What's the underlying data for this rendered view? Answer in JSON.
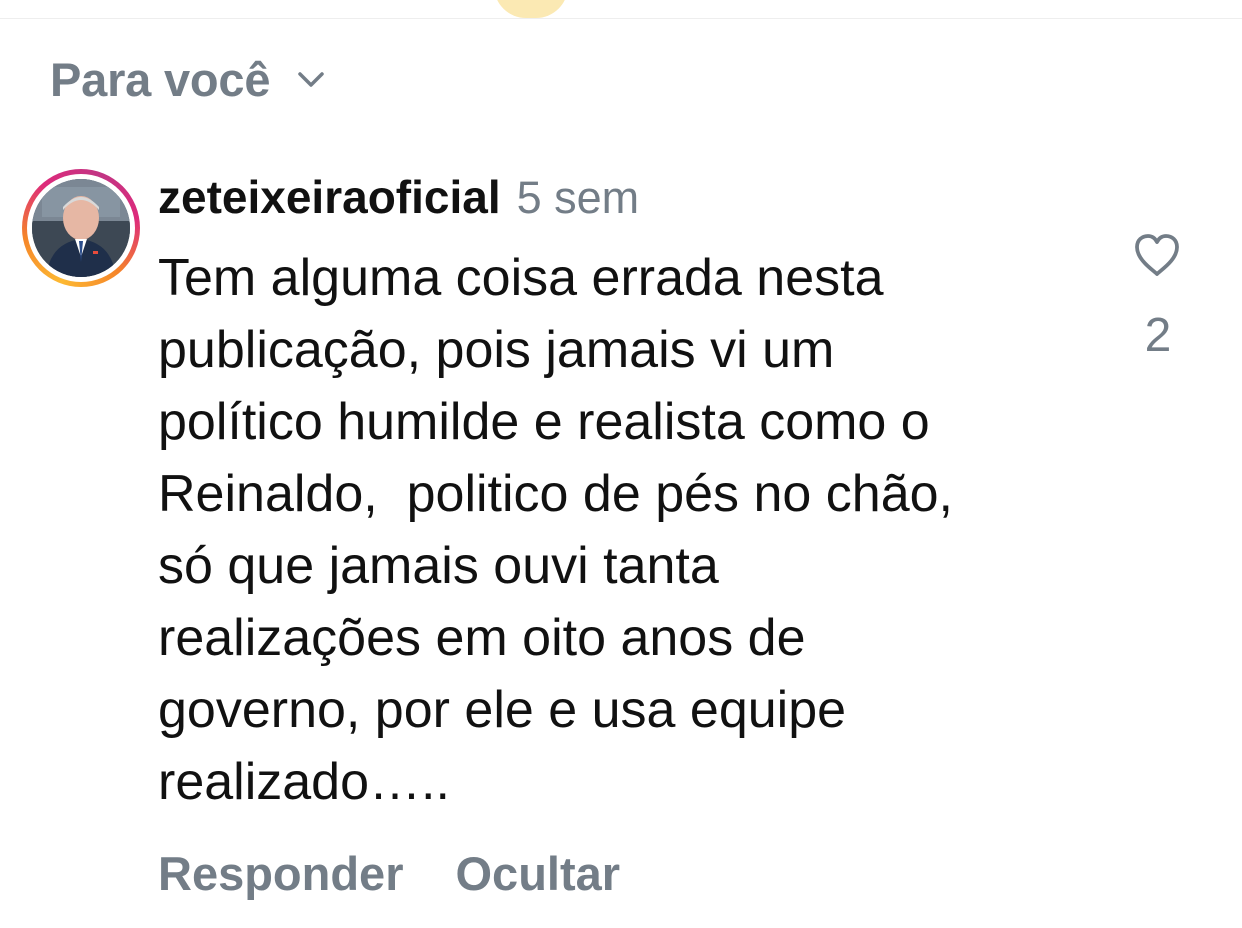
{
  "sort": {
    "label": "Para você",
    "chevron_icon": "chevron-down-icon"
  },
  "comment": {
    "username": "zeteixeiraoficial",
    "time": "5 sem",
    "avatar_icon": "user-avatar",
    "avatar_ring_colors": [
      "#fdb933",
      "#f58529",
      "#dd2a7b",
      "#c13584"
    ],
    "text_lines": [
      "Tem alguma coisa errada nesta",
      "publicação, pois jamais vi um",
      "político humilde e realista como o",
      "Reinaldo,  politico de pés no chão,",
      "só que jamais ouvi tanta",
      "realizações em oito anos de",
      "governo, por ele e usa equipe",
      "realizado….."
    ],
    "reply_label": "Responder",
    "hide_label": "Ocultar",
    "like_icon": "heart-outline-icon",
    "like_count": "2"
  },
  "colors": {
    "muted_text": "#737d87",
    "primary_text": "#111111",
    "background": "#ffffff"
  }
}
